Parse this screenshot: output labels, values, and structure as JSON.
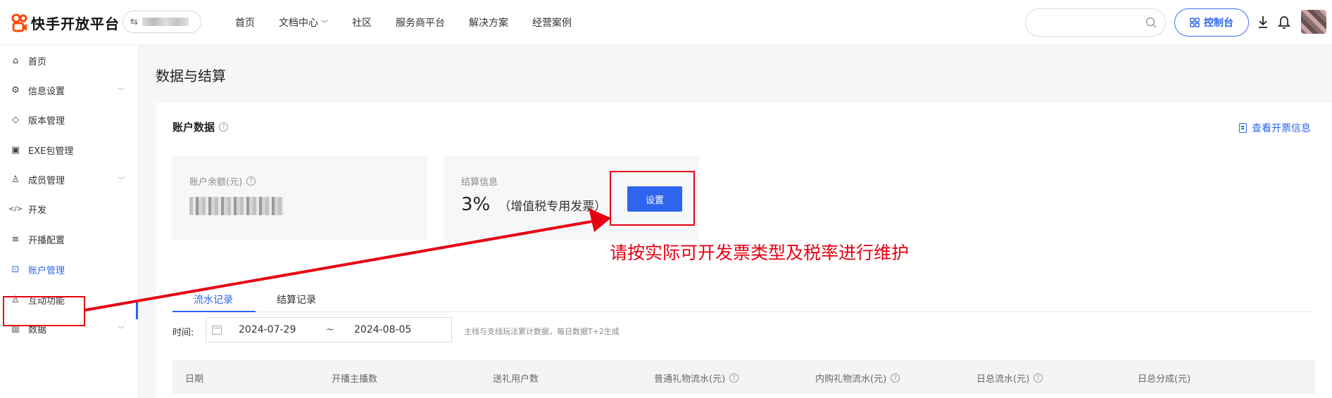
{
  "header": {
    "logo_text": "快手开放平台",
    "switcher_glyph": "⇆",
    "nav": [
      {
        "label": "首页",
        "dropdown": false
      },
      {
        "label": "文档中心",
        "dropdown": true
      },
      {
        "label": "社区",
        "dropdown": false
      },
      {
        "label": "服务商平台",
        "dropdown": false
      },
      {
        "label": "解决方案",
        "dropdown": false
      },
      {
        "label": "经营案例",
        "dropdown": false
      }
    ],
    "search_placeholder": "",
    "console_label": "控制台"
  },
  "sidebar": {
    "items": [
      {
        "label": "首页",
        "icon": "home-icon",
        "glyph": "⌂",
        "expandable": false
      },
      {
        "label": "信息设置",
        "icon": "gear-icon",
        "glyph": "⚙",
        "expandable": true
      },
      {
        "label": "版本管理",
        "icon": "layers-icon",
        "glyph": "◇",
        "expandable": false
      },
      {
        "label": "EXE包管理",
        "icon": "package-icon",
        "glyph": "▣",
        "expandable": false
      },
      {
        "label": "成员管理",
        "icon": "user-icon",
        "glyph": "♙",
        "expandable": true
      },
      {
        "label": "开发",
        "icon": "code-icon",
        "glyph": "</>",
        "expandable": false
      },
      {
        "label": "开播配置",
        "icon": "broadcast-icon",
        "glyph": "≡",
        "expandable": false
      },
      {
        "label": "账户管理",
        "icon": "account-icon",
        "glyph": "⊡",
        "expandable": false,
        "active": true
      },
      {
        "label": "互动功能",
        "icon": "interaction-icon",
        "glyph": "♙",
        "expandable": false
      },
      {
        "label": "数据",
        "icon": "chart-icon",
        "glyph": "▥",
        "expandable": true
      }
    ]
  },
  "page": {
    "title": "数据与结算",
    "card_title": "账户数据",
    "invoice_link": "查看开票信息",
    "balance_label": "账户余额(元)",
    "settlement_label": "结算信息",
    "settlement_rate": "3%",
    "settlement_type": "（增值税专用发票）",
    "set_button": "设置",
    "annotation": "请按实际可开发票类型及税率进行维护",
    "tabs": [
      "流水记录",
      "结算记录"
    ],
    "filter_label": "时间:",
    "date_start": "2024-07-29",
    "date_sep": "~",
    "date_end": "2024-08-05",
    "note": "主线与支线玩法累计数据，每日数据T+2生成",
    "table_headers": [
      {
        "label": "日期",
        "help": false
      },
      {
        "label": "开播主播数",
        "help": false
      },
      {
        "label": "送礼用户数",
        "help": false
      },
      {
        "label": "普通礼物流水(元)",
        "help": true
      },
      {
        "label": "内购礼物流水(元)",
        "help": true
      },
      {
        "label": "日总流水(元)",
        "help": true
      },
      {
        "label": "日总分成(元)",
        "help": false
      }
    ]
  },
  "colors": {
    "accent": "#2e64ee",
    "annotation": "#e60012"
  }
}
